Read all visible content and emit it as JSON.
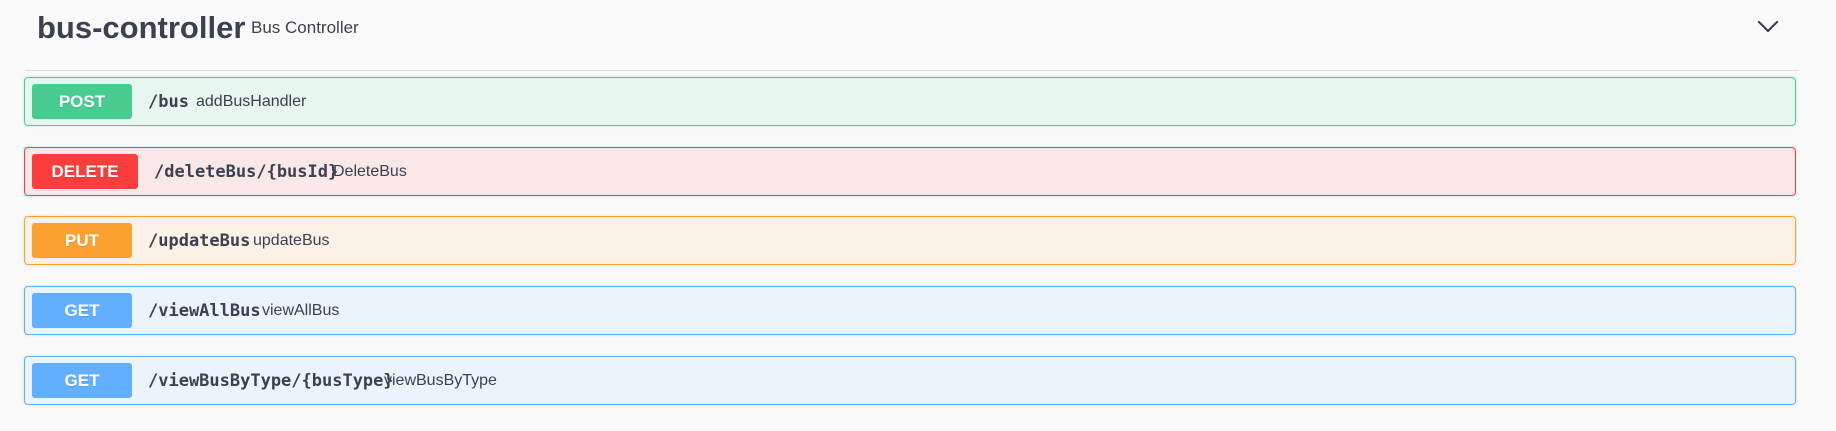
{
  "tag": {
    "name": "bus-controller",
    "description": "Bus Controller"
  },
  "colors": {
    "post": "#49cc90",
    "delete": "#f93e3e",
    "put": "#fca130",
    "get": "#61affe"
  },
  "operations": [
    {
      "method": "POST",
      "path": "/bus",
      "summary": "addBusHandler"
    },
    {
      "method": "DELETE",
      "path": "/deleteBus/{busId}",
      "summary": "DeleteBus"
    },
    {
      "method": "PUT",
      "path": "/updateBus",
      "summary": "updateBus"
    },
    {
      "method": "GET",
      "path": "/viewAllBus",
      "summary": "viewAllBus"
    },
    {
      "method": "GET",
      "path": "/viewBusByType/{busType}",
      "summary": "viewBusByType"
    }
  ],
  "icons": {
    "collapse": "chevron-down-icon"
  }
}
